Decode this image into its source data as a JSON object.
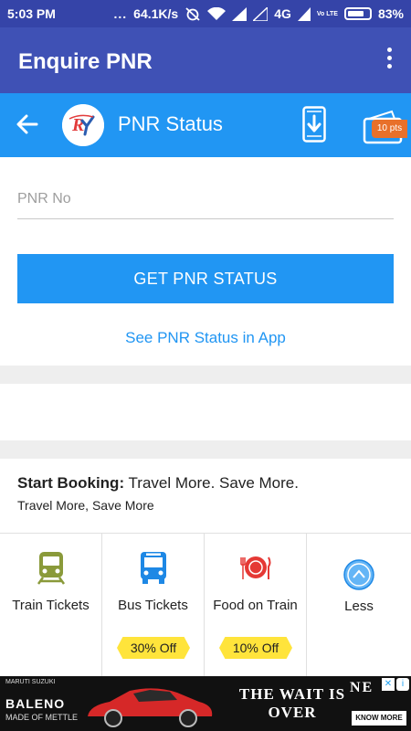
{
  "status_bar": {
    "time": "5:03 PM",
    "dots": "...",
    "network_speed": "64.1K/s",
    "network_type": "4G",
    "lte": "Vo LTE",
    "battery": "83%"
  },
  "app_bar": {
    "title": "Enquire PNR"
  },
  "sub_bar": {
    "title": "PNR Status",
    "points_badge": "10 pts"
  },
  "form": {
    "pnr_placeholder": "PNR No",
    "submit_label": "GET PNR STATUS",
    "app_link": "See PNR Status in App"
  },
  "booking": {
    "heading_bold": "Start Booking:",
    "heading_rest": "Travel More. Save More.",
    "subtext": "Travel More, Save More",
    "tiles": [
      {
        "label": "Train Tickets",
        "icon": "train-icon",
        "offer": ""
      },
      {
        "label": "Bus Tickets",
        "icon": "bus-icon",
        "offer": "30% Off"
      },
      {
        "label": "Food on Train",
        "icon": "food-icon",
        "offer": "10% Off"
      },
      {
        "label": "Less",
        "icon": "chevron-up-icon",
        "offer": ""
      }
    ]
  },
  "ad": {
    "brand": "MARUTI SUZUKI",
    "model": "BALENO",
    "tagline": "MADE OF METTLE",
    "headline": "THE WAIT IS OVER",
    "ne_text": "NE",
    "cta": "KNOW MORE"
  },
  "colors": {
    "status_bar": "#3544a8",
    "app_bar": "#3f51b5",
    "primary": "#2196f3",
    "offer_badge": "#ffe43b",
    "points_badge": "#e8702a"
  }
}
